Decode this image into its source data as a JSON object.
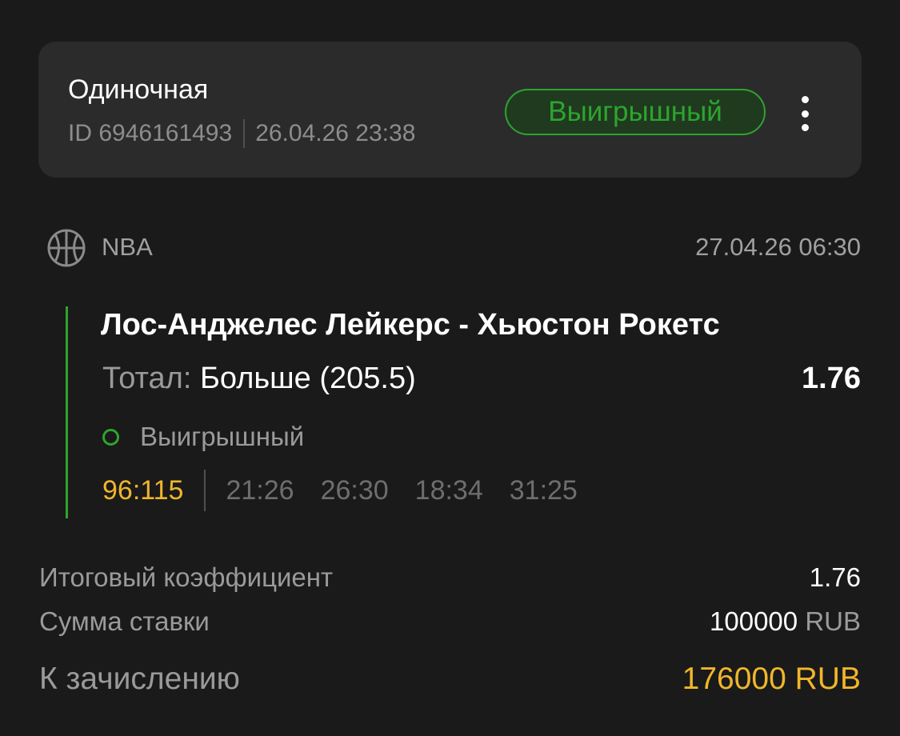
{
  "bet": {
    "type": "Одиночная",
    "id_label": "ID 6946161493",
    "placed_at": "26.04.26 23:38",
    "status": "Выигрышный",
    "status_color": "#2ea42e"
  },
  "event": {
    "sport_icon": "basketball-icon",
    "league": "NBA",
    "start_time": "27.04.26 06:30",
    "title": "Лос-Анджелес Лейкерс - Хьюстон Рокетс",
    "market_label": "Тотал:",
    "market_value": "Больше (205.5)",
    "odds": "1.76",
    "result": "Выигрышный",
    "score_total": "96:115",
    "periods": [
      "21:26",
      "26:30",
      "18:34",
      "31:25"
    ]
  },
  "summary": {
    "total_odds_label": "Итоговый коэффициент",
    "total_odds": "1.76",
    "stake_label": "Сумма ставки",
    "stake_amount": "100000",
    "stake_currency": "RUB",
    "payout_label": "К зачислению",
    "payout": "176000 RUB"
  },
  "colors": {
    "background": "#1a1a1a",
    "card": "#2b2b2b",
    "win_green": "#2ea42e",
    "accent_yellow": "#f0b62b"
  }
}
